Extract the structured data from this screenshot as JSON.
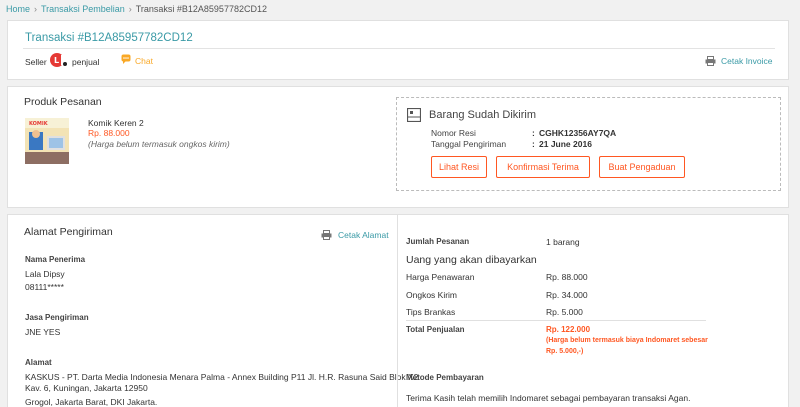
{
  "breadcrumb": {
    "home": "Home",
    "transaksi": "Transaksi Pembelian",
    "current": "Transaksi #B12A85957782CD12"
  },
  "header": {
    "title": "Transaksi #B12A85957782CD12",
    "seller_label": "Seller",
    "seller_name": "penjual",
    "chat_label": "Chat",
    "print_invoice": "Cetak Invoice"
  },
  "produk": {
    "heading": "Produk Pesanan",
    "item_name": "Komik Keren 2",
    "price": "Rp. 88.000",
    "note": "(Harga belum termasuk ongkos kirim)",
    "cover_text": "KOMIK"
  },
  "shipping_status": {
    "title": "Barang Sudah Dikirim",
    "resi_label": "Nomor Resi",
    "resi_value": "CGHK12356AY7QA",
    "date_label": "Tanggal Pengiriman",
    "date_value": "21 June 2016",
    "colon": ":",
    "btn_lihat": "Lihat Resi",
    "btn_konfirmasi": "Konfirmasi Terima",
    "btn_pengaduan": "Buat Pengaduan"
  },
  "alamat": {
    "heading": "Alamat Pengiriman",
    "print_label": "Cetak Alamat",
    "penerima_label": "Nama Penerima",
    "penerima_name": "Lala Dipsy",
    "penerima_phone": "08111*****",
    "jasa_label": "Jasa Pengiriman",
    "jasa_value": "JNE YES",
    "alamat_label": "Alamat",
    "alamat_line1": "KASKUS - PT. Darta Media Indonesia Menara Palma - Annex Building P11 Jl. H.R. Rasuna Said Blok X2",
    "alamat_line2": "Kav. 6, Kuningan, Jakarta 12950",
    "alamat_line3": "Grogol, Jakarta Barat, DKI Jakarta."
  },
  "ringkasan": {
    "jumlah_label": "Jumlah Pesanan",
    "jumlah_value": "1 barang",
    "uang_heading": "Uang yang akan dibayarkan",
    "harga_label": "Harga Penawaran",
    "harga_value": "Rp. 88.000",
    "ongkos_label": "Ongkos Kirim",
    "ongkos_value": "Rp. 34.000",
    "tips_label": "Tips Brankas",
    "tips_value": "Rp. 5.000",
    "total_label": "Total Penjualan",
    "total_value": "Rp. 122.000",
    "total_note1": "(Harga belum termasuk biaya Indomaret sebesar",
    "total_note2": "Rp. 5.000,-)",
    "metode_label": "Metode Pembayaran",
    "metode_text": "Terima Kasih telah memilih Indomaret sebagai pembayaran transaksi Agan."
  },
  "colors": {
    "accent_teal": "#3a9aa6",
    "accent_orange": "#ff5722",
    "chat_yellow": "#f9a826",
    "link_green": "#42b549"
  },
  "icons": [
    "chevron-right-icon",
    "seller-logo-icon",
    "chat-icon",
    "printer-icon",
    "package-icon"
  ]
}
